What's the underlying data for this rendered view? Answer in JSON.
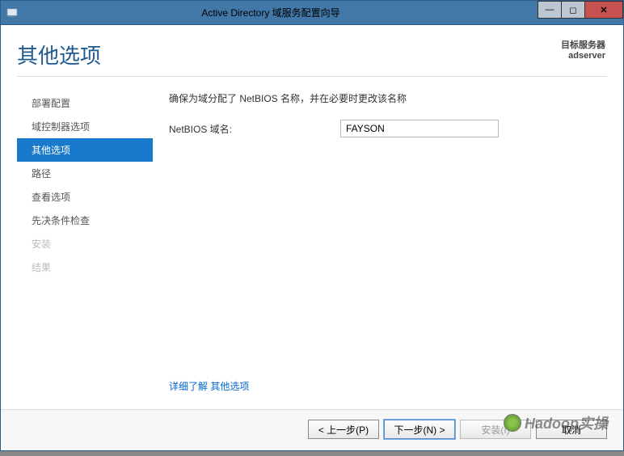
{
  "window": {
    "title": "Active Directory 域服务配置向导"
  },
  "header": {
    "page_title": "其他选项",
    "target_label": "目标服务器",
    "target_name": "adserver"
  },
  "sidebar": {
    "items": [
      {
        "label": "部署配置"
      },
      {
        "label": "域控制器选项"
      },
      {
        "label": "其他选项"
      },
      {
        "label": "路径"
      },
      {
        "label": "查看选项"
      },
      {
        "label": "先决条件检查"
      },
      {
        "label": "安装"
      },
      {
        "label": "结果"
      }
    ]
  },
  "main": {
    "instruction": "确保为域分配了 NetBIOS 名称，并在必要时更改该名称",
    "netbios_label": "NetBIOS 域名:",
    "netbios_value": "FAYSON",
    "help_prefix": "详细了解 ",
    "help_link": "其他选项"
  },
  "footer": {
    "prev": "< 上一步(P)",
    "next": "下一步(N) >",
    "install": "安装(I)",
    "cancel": "取消"
  },
  "watermark": "Hadoop实操"
}
